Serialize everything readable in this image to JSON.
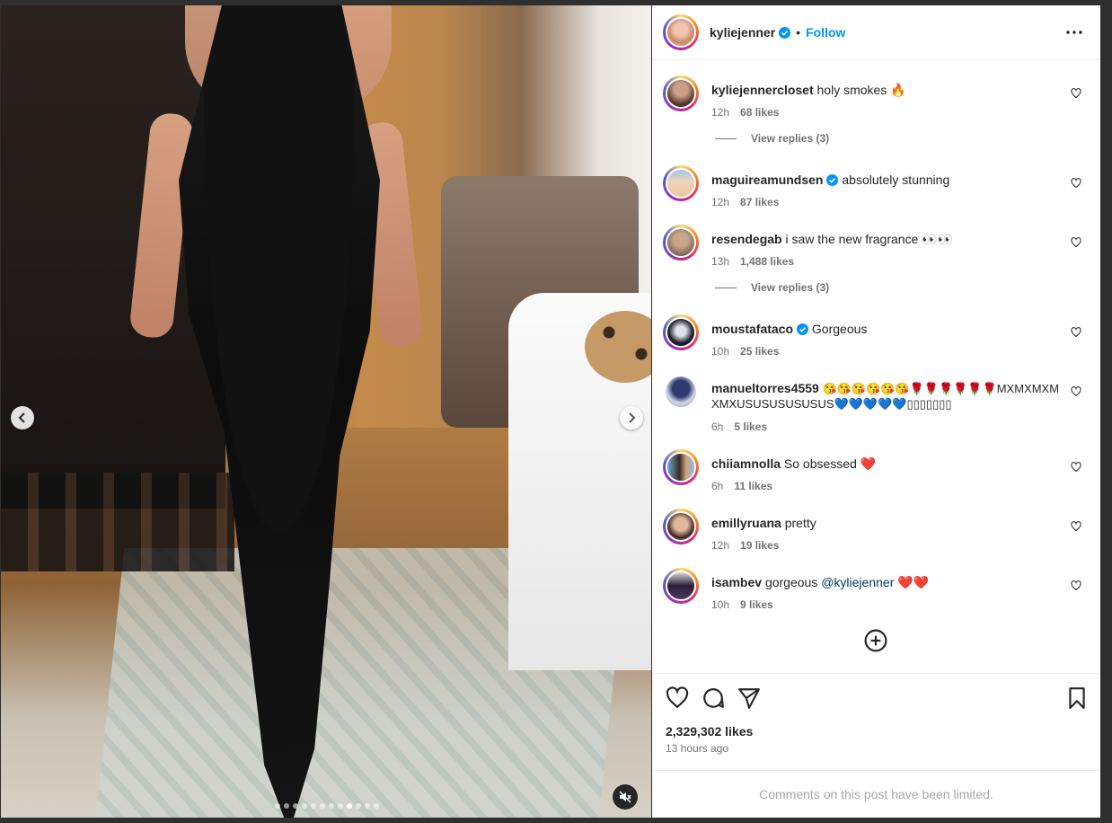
{
  "post": {
    "author": "kyliejenner",
    "follow_label": "Follow",
    "dot_separator": "•",
    "likes": "2,329,302 likes",
    "time": "13 hours ago",
    "limited_notice": "Comments on this post have been limited.",
    "carousel": {
      "total_slides": 12,
      "active_slide": 9
    }
  },
  "comments": [
    {
      "user": "kyliejennercloset",
      "text": "holy smokes 🔥",
      "time": "12h",
      "likes": "68 likes",
      "verified": false,
      "replies": "View replies (3)"
    },
    {
      "user": "maguireamundsen",
      "text": "absolutely stunning",
      "time": "12h",
      "likes": "87 likes",
      "verified": true
    },
    {
      "user": "resendegab",
      "text": "i saw the new fragrance 👀👀",
      "time": "13h",
      "likes": "1,488 likes",
      "verified": false,
      "replies": "View replies (3)"
    },
    {
      "user": "moustafataco",
      "text": "Gorgeous",
      "time": "10h",
      "likes": "25 likes",
      "verified": true
    },
    {
      "user": "manueltorres4559",
      "text": "😘😘😘😘😘😘🌹🌹🌹🌹🌹🌹MXMXMXMXMXUSUSUSUSUSUS💙💙💙💙💙▯▯▯▯▯▯▯",
      "time": "6h",
      "likes": "5 likes",
      "verified": false
    },
    {
      "user": "chiiamnolla",
      "text": "So obsessed ❤️",
      "time": "6h",
      "likes": "11 likes",
      "verified": false
    },
    {
      "user": "emillyruana",
      "text": "pretty",
      "time": "12h",
      "likes": "19 likes",
      "verified": false
    },
    {
      "user": "isambev",
      "text_before": "gorgeous ",
      "mention": "@kyliejenner",
      "text_after": " ❤️❤️",
      "time": "10h",
      "likes": "9 likes",
      "verified": false
    }
  ],
  "icons": {
    "prev": "chevron-left-icon",
    "next": "chevron-right-icon",
    "mute": "speaker-muted-icon",
    "more": "more-horizontal-icon",
    "verified": "verified-badge-icon",
    "comment_like": "heart-outline-icon",
    "load_more": "plus-circle-icon",
    "like": "heart-icon",
    "comment": "comment-bubble-icon",
    "share": "send-icon",
    "save": "bookmark-icon"
  },
  "colors": {
    "follow": "#0095f6",
    "verified": "#0095f6",
    "mention": "#00376b",
    "muted_text": "#737373",
    "limited_text": "#a8a8a8"
  }
}
